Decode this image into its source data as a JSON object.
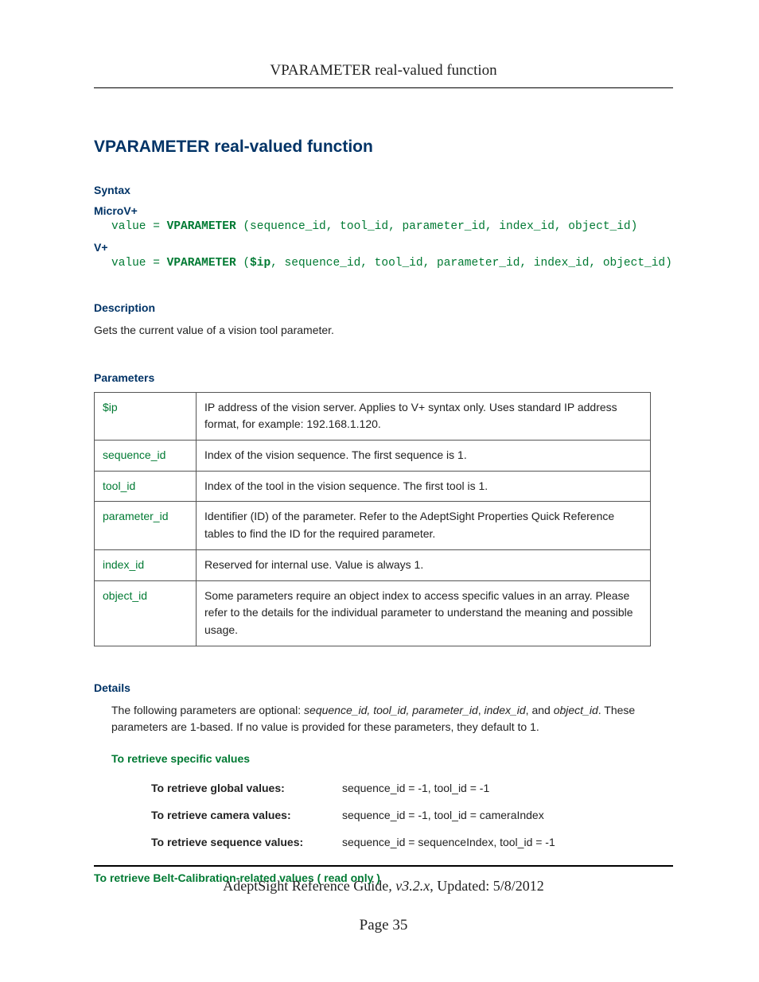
{
  "header": {
    "running": "VPARAMETER real-valued function"
  },
  "title": "VPARAMETER real-valued function",
  "syntax": {
    "label": "Syntax",
    "microv_label": "MicroV+",
    "microv_prefix": "value = ",
    "microv_kw": "VPARAMETER",
    "microv_args": " (sequence_id, tool_id, parameter_id, index_id, object_id)",
    "vplus_label": "V+",
    "vplus_prefix": "value = ",
    "vplus_kw1": "VPARAMETER",
    "vplus_mid": " (",
    "vplus_kw2": "$ip",
    "vplus_args": ", sequence_id, tool_id, parameter_id, index_id, object_id)"
  },
  "description": {
    "label": "Description",
    "text": "Gets the current value of a vision tool parameter."
  },
  "parameters": {
    "label": "Parameters",
    "rows": [
      {
        "name": "$ip",
        "desc": "IP address of the vision server. Applies to V+ syntax only. Uses standard IP address format, for example: 192.168.1.120."
      },
      {
        "name": "sequence_id",
        "desc": "Index of the vision sequence. The first sequence is 1."
      },
      {
        "name": "tool_id",
        "desc": "Index of the tool in the vision sequence. The first tool is 1."
      },
      {
        "name": "parameter_id",
        "desc": "Identifier (ID) of the parameter. Refer to the AdeptSight Properties Quick Reference tables to find the ID for the required parameter."
      },
      {
        "name": "index_id",
        "desc": "Reserved for internal use. Value is always 1."
      },
      {
        "name": "object_id",
        "desc": "Some parameters require an object index to access specific values in an array. Please refer to the details for the individual parameter to understand the meaning and possible usage."
      }
    ]
  },
  "details": {
    "label": "Details",
    "para_pre": "The following parameters are optional: ",
    "para_it": "sequence_id, tool_id, parameter_id",
    "para_mid1": ", ",
    "para_it2": "index_id",
    "para_mid2": ", and ",
    "para_it3": "object_id",
    "para_post": ". These parameters are 1-based. If no value is provided for these parameters, they default to 1.",
    "specific_heading": "To retrieve specific values",
    "rows": [
      {
        "label": "To retrieve global values:",
        "val": "sequence_id = -1, tool_id = -1"
      },
      {
        "label": "To retrieve camera values:",
        "val": "sequence_id = -1, tool_id = cameraIndex"
      },
      {
        "label": "To retrieve sequence values:",
        "val": "sequence_id = sequenceIndex, tool_id = -1"
      }
    ],
    "belt_heading": "To retrieve Belt-Calibration-related values ( read only )"
  },
  "footer": {
    "guide": "AdeptSight Reference Guide",
    "version": ", v3.2.x",
    "updated": ", Updated: 5/8/2012",
    "page": "Page 35"
  }
}
